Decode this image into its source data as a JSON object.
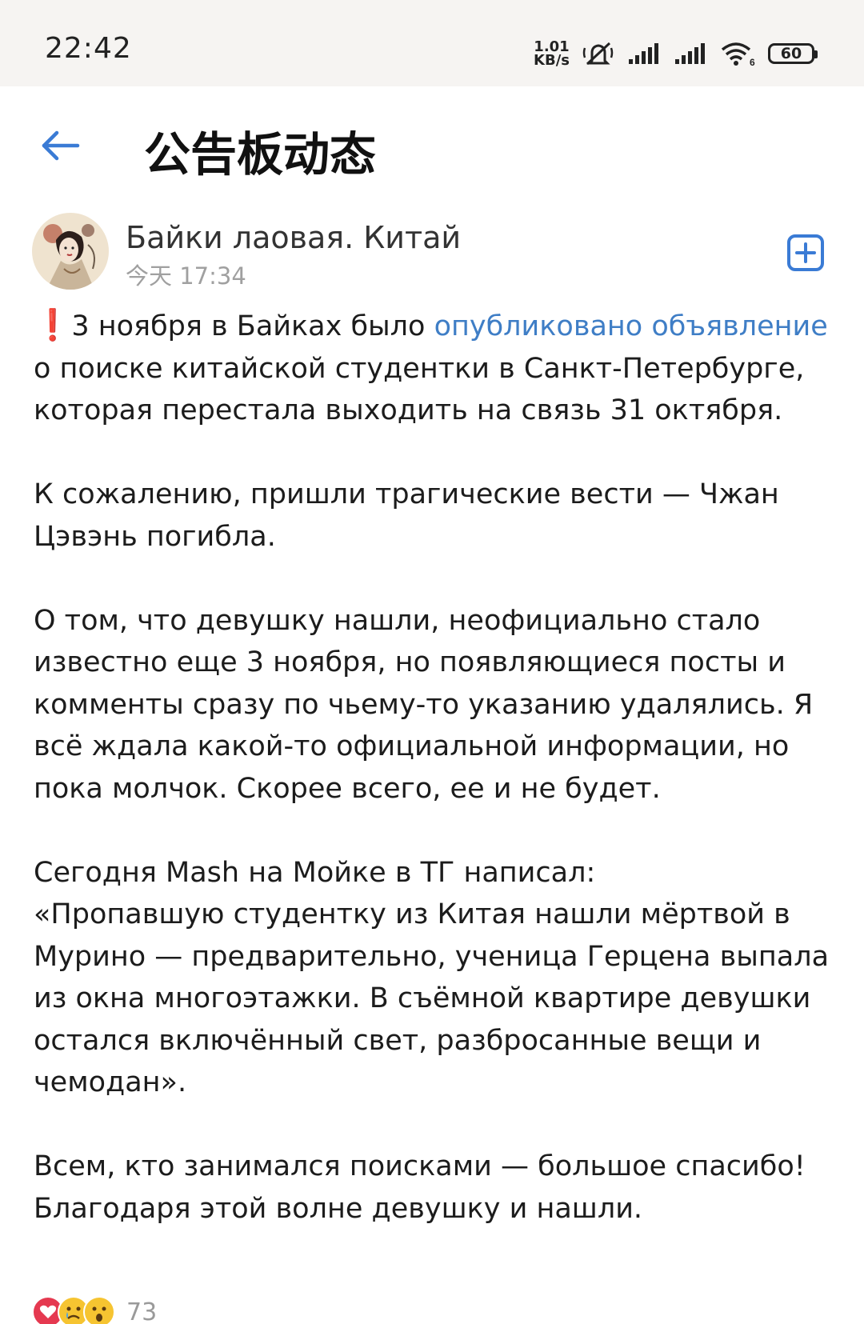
{
  "status_bar": {
    "time": "22:42",
    "net_speed_value": "1.01",
    "net_speed_unit": "KB/s",
    "battery": "60",
    "icons": [
      "mute-icon",
      "signal-icon",
      "signal-icon",
      "wifi-icon",
      "battery-icon"
    ]
  },
  "header": {
    "title": "公告板动态",
    "back_icon": "arrow-left-icon"
  },
  "post": {
    "author": "Байки лаовая. Китай",
    "time": "今天 17:34",
    "add_icon": "plus-square-icon",
    "p1": {
      "emoji": "❗",
      "text_before": "3 ноября в Байках было ",
      "link": "опубликовано объявление",
      "text_after": " о поиске китайской студентки в Санкт-Петербурге, которая перестала выходить на связь 31 октября."
    },
    "p2": "К сожалению, пришли трагические вести — Чжан Цэвэнь погибла.",
    "p3": "О том, что девушку нашли, неофициально стало известно еще 3 ноября, но появляющиеся посты и комменты сразу по чьему-то указанию удалялись. Я всё ждала какой-то официальной информации, но пока молчок. Скорее всего, ее и не будет.",
    "p4_line1": "Сегодня Mash на Мойке в ТГ написал:",
    "p4_rest": "«Пропавшую студентку из Китая нашли мёртвой в Мурино — предварительно, ученица Герцена выпала из окна многоэтажки. В съёмной квартире девушки остался включённый свет, разбросанные вещи и чемодан».",
    "p5": "Всем, кто занимался поисками — большое спасибо! Благодаря этой волне девушку и нашли."
  },
  "reactions": {
    "icons": [
      "heart-icon",
      "crying-face-icon",
      "surprised-face-icon"
    ],
    "count": "73"
  },
  "colors": {
    "link": "#3f7ec6",
    "accent": "#3a7bd5",
    "status_bar_bg": "#f6f4f2"
  }
}
